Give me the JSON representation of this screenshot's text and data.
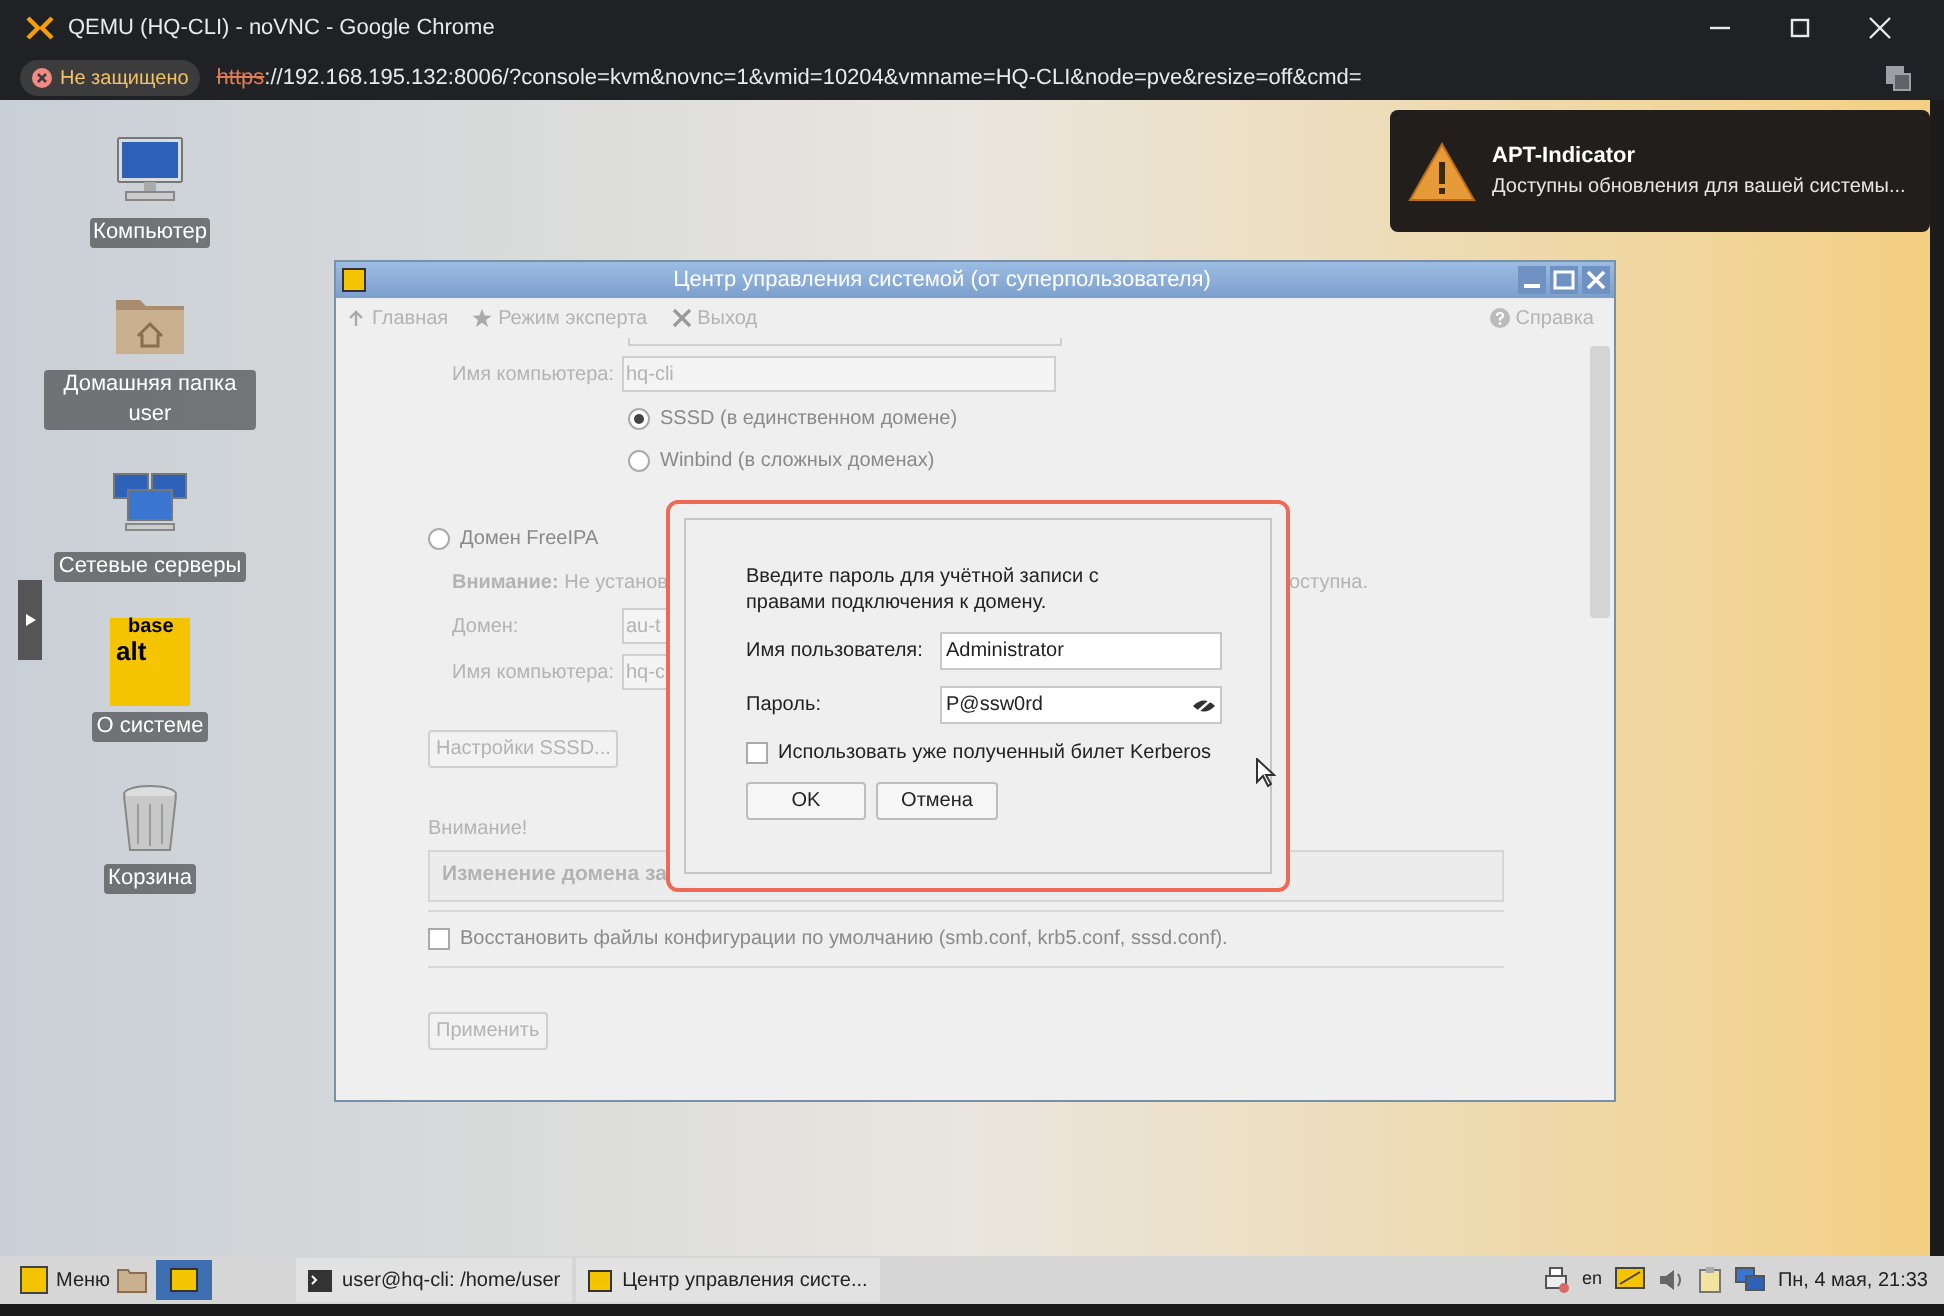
{
  "browser": {
    "title": "QEMU (HQ-CLI) - noVNC - Google Chrome",
    "security_label": "Не защищено",
    "url_scheme": "https",
    "url_rest": "://192.168.195.132:8006/?console=kvm&novnc=1&vmid=10204&vmname=HQ-CLI&node=pve&resize=off&cmd="
  },
  "desktop_icons": [
    {
      "kind": "computer",
      "label": "Компьютер"
    },
    {
      "kind": "home",
      "label": "Домашняя папка user"
    },
    {
      "kind": "network",
      "label": "Сетевые серверы"
    },
    {
      "kind": "about",
      "label": "О системе",
      "logo_top": "base",
      "logo_bottom": "alt"
    },
    {
      "kind": "trash",
      "label": "Корзина"
    }
  ],
  "notification": {
    "title": "APT-Indicator",
    "message": "Доступны обновления для вашей системы..."
  },
  "window": {
    "title": "Центр управления системой (от суперпользователя)",
    "toolbar": [
      {
        "kind": "up",
        "label": "Главная"
      },
      {
        "kind": "star",
        "label": "Режим эксперта"
      },
      {
        "kind": "exit",
        "label": "Выход"
      }
    ],
    "help": "Справка",
    "disabled": true,
    "form": {
      "computer_label": "Имя компьютера:",
      "computer_value": "hq-cli",
      "backends": [
        {
          "label": "SSSD (в единственном домене)",
          "selected": true
        },
        {
          "label": "Winbind (в сложных доменах)",
          "selected": false
        }
      ],
      "freeipa": {
        "label": "Домен FreeIPA",
        "selected": false
      },
      "warning_left": "**Внимание:** Не установ",
      "warning_right": "оступна.",
      "domain_label": "Домен:",
      "domain_value": "au-t",
      "ipa_computer_label": "Имя компьютера:",
      "ipa_computer_value": "hq-c",
      "sssd_button": "Настройки SSSD...",
      "notice_title": "Внимание!",
      "notice_text": "Изменение домена за",
      "restore": {
        "label": "Восстановить файлы конфигурации по умолчанию (smb.conf, krb5.conf, sssd.conf).",
        "checked": false
      },
      "apply_button": "Применить"
    }
  },
  "dialog": {
    "prompt": "Введите пароль для учётной записи с правами подключения к домену.",
    "user_label": "Имя пользователя:",
    "user_value": "Administrator",
    "password_label": "Пароль:",
    "password_value": "P@ssw0rd",
    "kerberos": {
      "label": "Использовать уже полученный билет Kerberos",
      "checked": false
    },
    "ok": "OK",
    "cancel": "Отмена"
  },
  "taskbar": {
    "menu": "Меню",
    "tasks": [
      {
        "kind": "terminal",
        "label": "user@hq-cli: /home/user"
      },
      {
        "kind": "control",
        "label": "Центр управления систе..."
      }
    ],
    "layout": "en",
    "clock": "Пн, 4 мая, 21:33"
  }
}
